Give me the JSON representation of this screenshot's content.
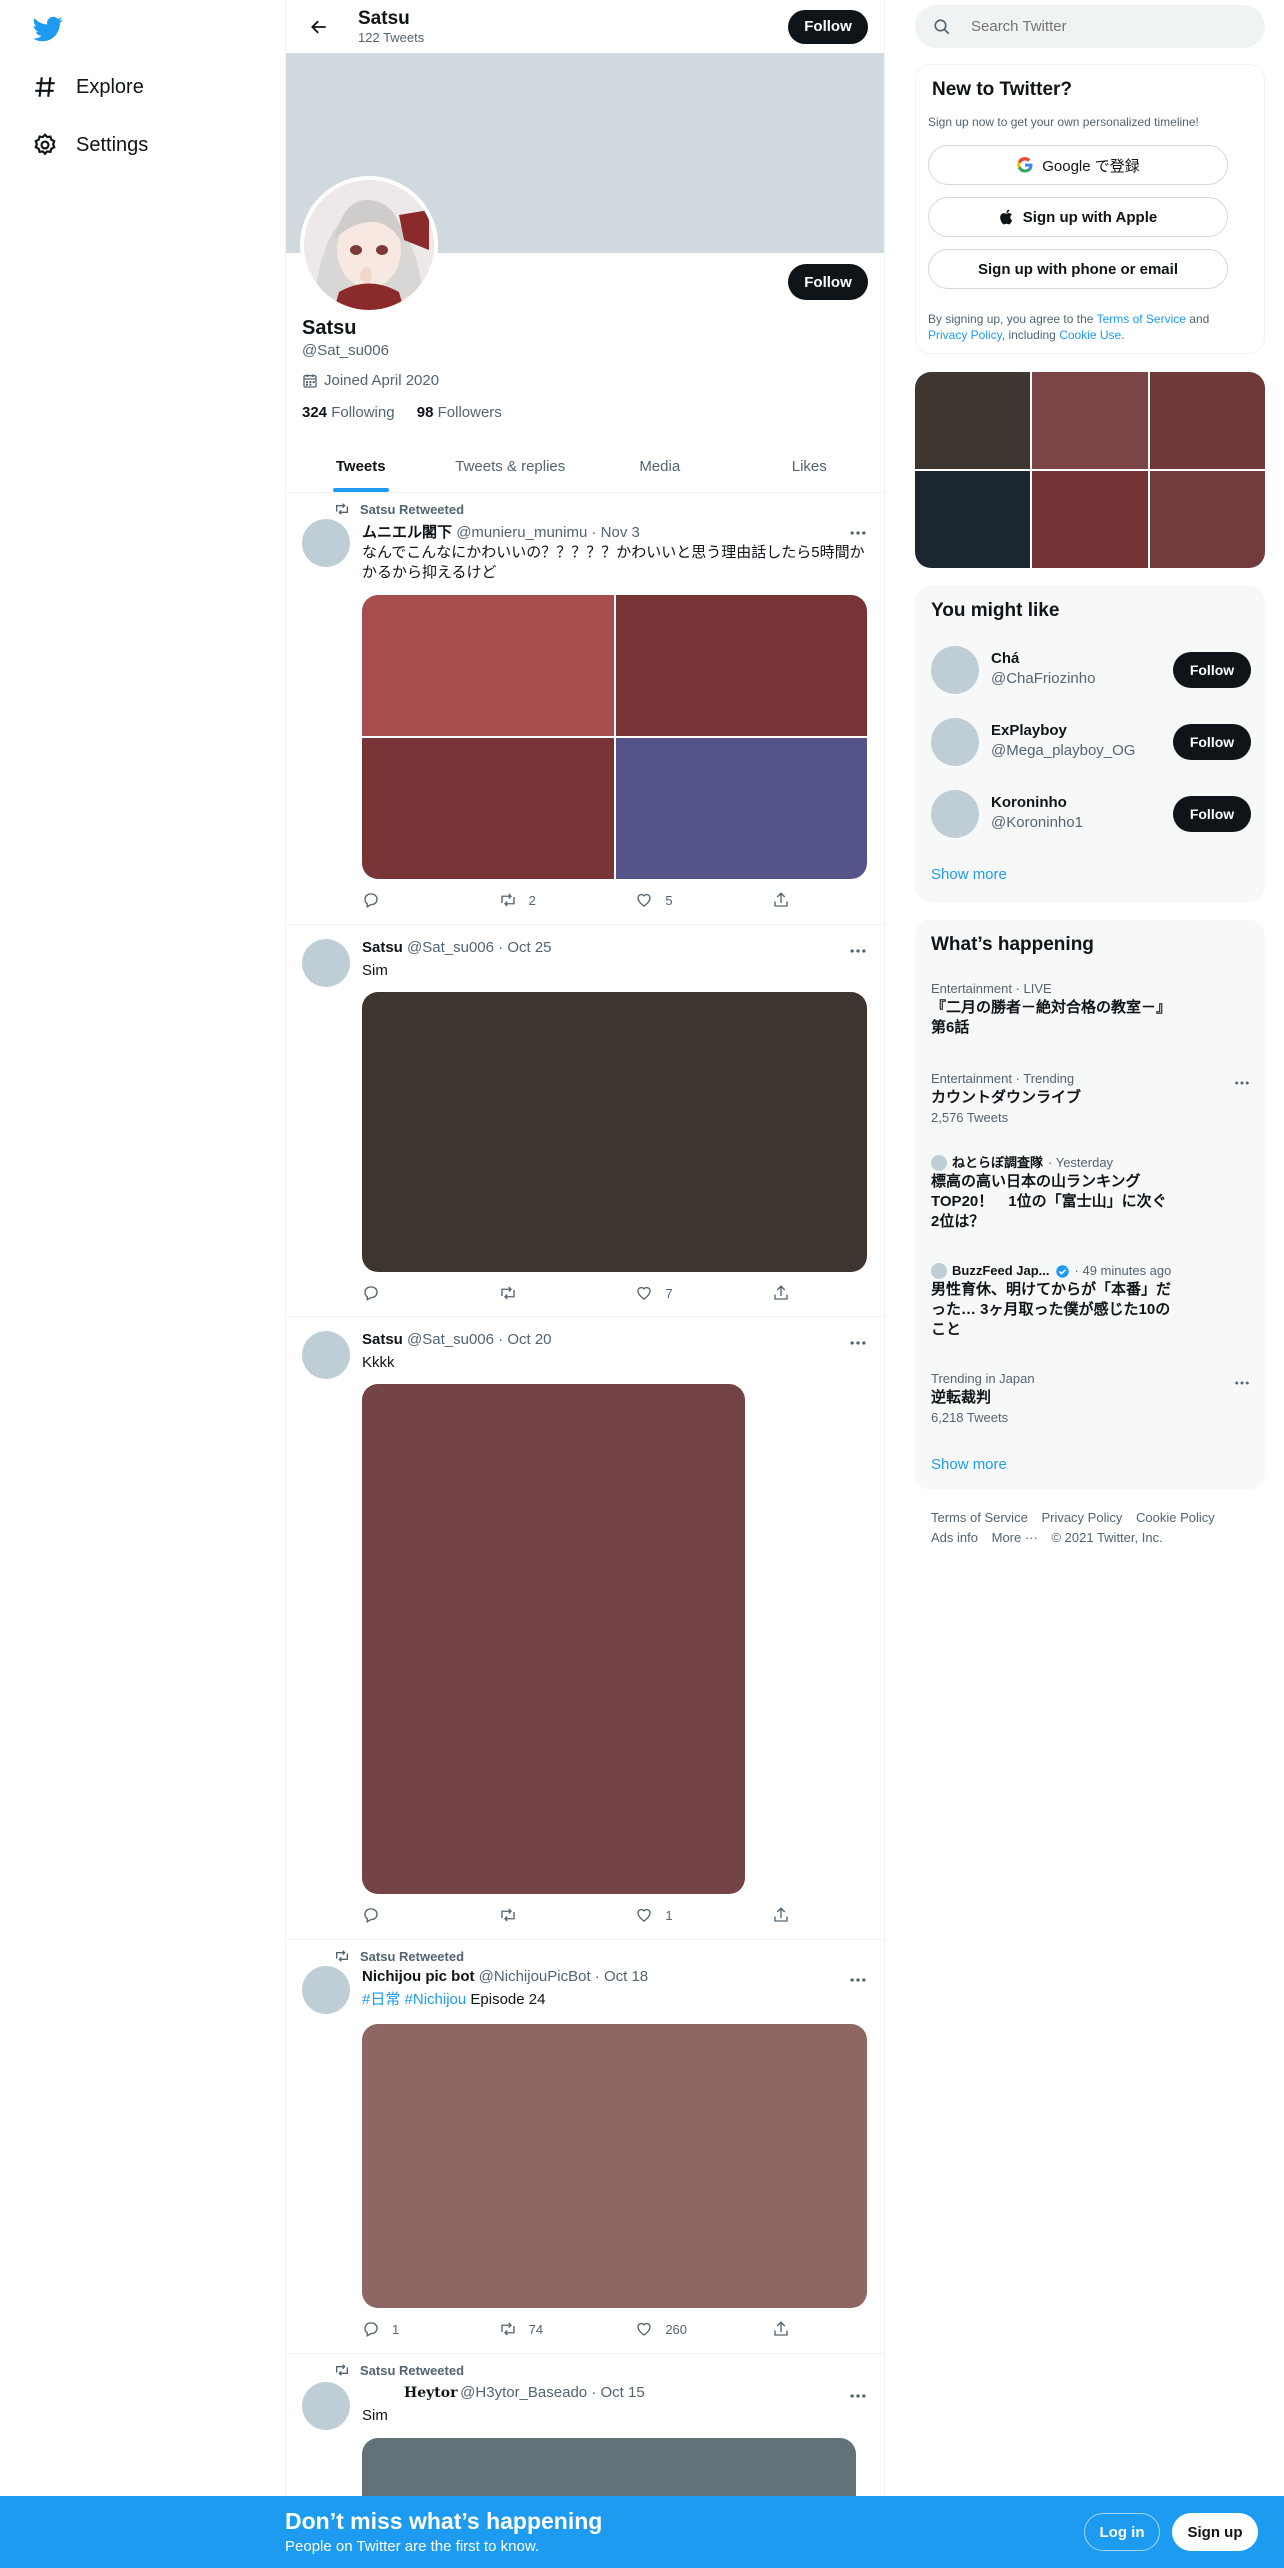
{
  "nav": {
    "explore_label": "Explore",
    "settings_label": "Settings"
  },
  "header": {
    "name": "Satsu",
    "tweet_count": "122 Tweets",
    "follow_label": "Follow"
  },
  "profile": {
    "name": "Satsu",
    "handle": "@Sat_su006",
    "joined": "Joined April 2020",
    "following_count": "324",
    "following_label": "Following",
    "followers_count": "98",
    "followers_label": "Followers",
    "follow_label": "Follow"
  },
  "tabs": [
    {
      "label": "Tweets",
      "active": true
    },
    {
      "label": "Tweets & replies",
      "active": false
    },
    {
      "label": "Media",
      "active": false
    },
    {
      "label": "Likes",
      "active": false
    }
  ],
  "tweets": [
    {
      "retweeted_by": "Satsu Retweeted",
      "name": "ムニエル閣下",
      "handle": "@munieru_munimu",
      "date": "· Nov 3",
      "text": "なんでこんなにかわいいの？？？？？かわいいと思う理由話したら5時間かかるから抑えるけど",
      "media_colors": [
        "#a84d4d",
        "#773336",
        "#773336",
        "#545489"
      ],
      "reply_count": "",
      "retweet_count": "2",
      "like_count": "5"
    },
    {
      "retweeted_by": "",
      "name": "Satsu",
      "handle": "@Sat_su006",
      "date": "· Oct 25",
      "text": "Sim",
      "media_colors": [
        "#3e352e"
      ],
      "reply_count": "",
      "retweet_count": "",
      "like_count": "7"
    },
    {
      "retweeted_by": "",
      "name": "Satsu",
      "handle": "@Sat_su006",
      "date": "· Oct 20",
      "text": "Kkkk",
      "media_colors": [
        "#744346"
      ],
      "reply_count": "",
      "retweet_count": "",
      "like_count": "1"
    },
    {
      "retweeted_by": "Satsu Retweeted",
      "name": "Nichijou pic bot",
      "handle": "@NichijouPicBot",
      "date": "· Oct 18",
      "hashtags": [
        "#日常",
        "#Nichijou"
      ],
      "text": "Episode 24",
      "media_colors": [
        "#8e6663"
      ],
      "reply_count": "1",
      "retweet_count": "74",
      "like_count": "260"
    },
    {
      "retweeted_by": "Satsu Retweeted",
      "name": "Heytor",
      "handle": "@H3ytor_Baseado",
      "date": "· Oct 15",
      "text": "Sim",
      "media_colors": [
        "#637279"
      ]
    }
  ],
  "search": {
    "placeholder": "Search Twitter"
  },
  "new_to_twitter": {
    "title": "New to Twitter?",
    "subtitle": "Sign up now to get your own personalized timeline!",
    "google_label": "Google で登録",
    "apple_label": "Sign up with Apple",
    "phone_label": "Sign up with phone or email",
    "terms_prefix": "By signing up, you agree to the",
    "terms_link": "Terms of Service",
    "terms_and": "and",
    "privacy_link": "Privacy Policy",
    "terms_including": ", including",
    "cookie_link": "Cookie Use",
    "terms_end": "."
  },
  "photo_grid_colors": [
    "#3e362f",
    "#7b4446",
    "#713838",
    "#1b2631",
    "#743335",
    "#733b3d"
  ],
  "you_might_like": {
    "title": "You might like",
    "users": [
      {
        "name": "Chá",
        "handle": "@ChaFriozinho",
        "follow": "Follow"
      },
      {
        "name": "ExPlayboy",
        "handle": "@Mega_playboy_OG",
        "follow": "Follow"
      },
      {
        "name": "Koroninho",
        "handle": "@Koroninho1",
        "follow": "Follow"
      }
    ],
    "show_more": "Show more"
  },
  "whats_happening": {
    "title": "What’s happening",
    "trends": [
      {
        "meta": "Entertainment · LIVE",
        "title": "『二月の勝者－絶対合格の教室－』第6話",
        "count": ""
      },
      {
        "meta": "Entertainment · Trending",
        "title": "カウントダウンライブ",
        "count": "2,576 Tweets"
      },
      {
        "meta_author": "ねとらぼ調査隊",
        "meta_time": "· Yesterday",
        "title": "標高の高い日本の山ランキングTOP20！　1位の「富士山」に次ぐ2位は？",
        "count": ""
      },
      {
        "meta_author": "BuzzFeed Jap...",
        "meta_time": "· 49 minutes ago",
        "title": "男性育休、明けてからが「本番」だった… 3ヶ月取った僕が感じた10のこと",
        "count": ""
      },
      {
        "meta": "Trending in Japan",
        "title": "逆転裁判",
        "count": "6,218 Tweets"
      }
    ],
    "show_more": "Show more"
  },
  "footer": {
    "terms": "Terms of Service",
    "privacy": "Privacy Policy",
    "cookie": "Cookie Policy",
    "ads": "Ads info",
    "more": "More ···",
    "copyright": "© 2021 Twitter, Inc."
  },
  "bottom_bar": {
    "title": "Don’t miss what’s happening",
    "subtitle": "People on Twitter are the first to know.",
    "login": "Log in",
    "signup": "Sign up"
  }
}
